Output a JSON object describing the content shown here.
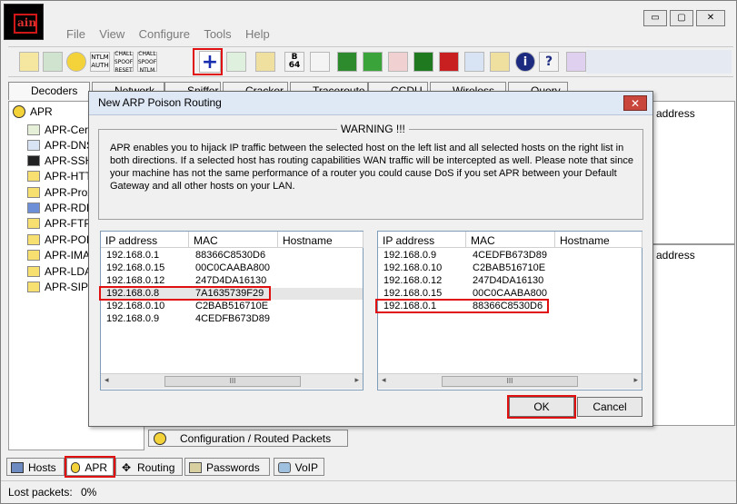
{
  "app": {
    "logo_text": "ain"
  },
  "menu": [
    "File",
    "View",
    "Configure",
    "Tools",
    "Help"
  ],
  "window_controls": {
    "minimize": "▭",
    "maximize": "▢",
    "close": "✕"
  },
  "toolbar": {
    "labels": [
      "NTLM AUTH",
      "CHALL SPOOF RESET",
      "CHALL SPOOF NTLM",
      "B 64"
    ],
    "add_label": "+",
    "info_label": "i",
    "help_label": "?"
  },
  "top_tabs": [
    "Decoders",
    "Network",
    "Sniffer",
    "Cracker",
    "Traceroute",
    "CCDU",
    "Wireless",
    "Query"
  ],
  "tree": {
    "root": "APR",
    "items": [
      "APR-Cert",
      "APR-DNS",
      "APR-SSH",
      "APR-HTTP",
      "APR-Prox",
      "APR-RDP",
      "APR-FTPS",
      "APR-POP",
      "APR-IMA",
      "APR-LDA",
      "APR-SIPS"
    ]
  },
  "right_panel": {
    "header_top": "address",
    "header_bottom": "address"
  },
  "dialog": {
    "title": "New ARP Poison Routing",
    "close": "✕",
    "warning_title": "WARNING !!!",
    "warning_text": "APR enables you to hijack IP traffic between the selected host on the left list and all selected hosts on the right list in both directions. If a selected host has routing capabilities WAN traffic will be intercepted as well. Please note that since your machine has not the same performance of a router you could cause DoS if you set APR between your Default Gateway and all other hosts on your LAN.",
    "columns": [
      "IP address",
      "MAC",
      "Hostname"
    ],
    "left_rows": [
      {
        "ip": "192.168.0.1",
        "mac": "88366C8530D6",
        "host": ""
      },
      {
        "ip": "192.168.0.15",
        "mac": "00C0CAABA800",
        "host": ""
      },
      {
        "ip": "192.168.0.12",
        "mac": "247D4DA16130",
        "host": ""
      },
      {
        "ip": "192.168.0.8",
        "mac": "7A1635739F29",
        "host": ""
      },
      {
        "ip": "192.168.0.10",
        "mac": "C2BAB516710E",
        "host": ""
      },
      {
        "ip": "192.168.0.9",
        "mac": "4CEDFB673D89",
        "host": ""
      }
    ],
    "right_rows": [
      {
        "ip": "192.168.0.9",
        "mac": "4CEDFB673D89",
        "host": ""
      },
      {
        "ip": "192.168.0.10",
        "mac": "C2BAB516710E",
        "host": ""
      },
      {
        "ip": "192.168.0.12",
        "mac": "247D4DA16130",
        "host": ""
      },
      {
        "ip": "192.168.0.15",
        "mac": "00C0CAABA800",
        "host": ""
      },
      {
        "ip": "192.168.0.1",
        "mac": "88366C8530D6",
        "host": ""
      }
    ],
    "scroll_thumb": "III",
    "scroll_left": "◂",
    "scroll_right": "▸",
    "ok": "OK",
    "cancel": "Cancel"
  },
  "subtab": "Configuration / Routed Packets",
  "bottom_tabs": [
    "Hosts",
    "APR",
    "Routing",
    "Passwords",
    "VoIP"
  ],
  "status": {
    "label": "Lost packets:",
    "value": "0%"
  },
  "colors": {
    "highlight": "#e01010",
    "selected_row": "#e6e6e6",
    "title_bar": "#dfe8f5"
  }
}
